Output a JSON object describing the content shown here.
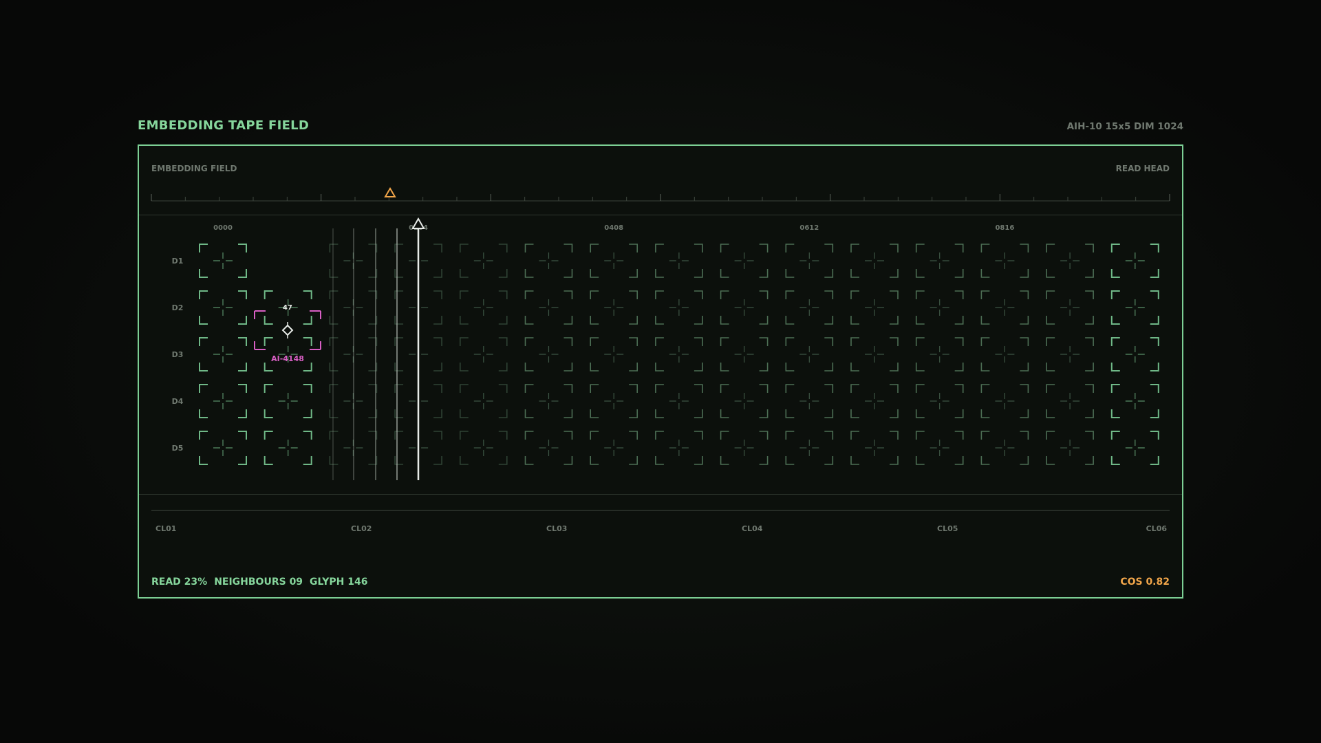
{
  "header": {
    "title": "EMBEDDING TAPE FIELD",
    "meta": "AIH-10  15x5  DIM 1024"
  },
  "ruler": {
    "left_label": "EMBEDDING FIELD",
    "right_label": "READ HEAD"
  },
  "field": {
    "column_labels": [
      "0000",
      "0204",
      "0408",
      "0612",
      "0816"
    ],
    "rows": [
      "D1",
      "D2",
      "D3",
      "D4",
      "D5"
    ],
    "selected": {
      "label": "AI-4148",
      "count": "47"
    }
  },
  "clusters": [
    "CL01",
    "CL02",
    "CL03",
    "CL04",
    "CL05",
    "CL06"
  ],
  "footer": {
    "read": "READ 23%",
    "neighbours": "NEIGHBOURS 09",
    "glyph": "GLYPH 146",
    "cos": "COS 0.82"
  },
  "colors": {
    "accent": "#7ccf94",
    "selection": "#d85fc4",
    "warning": "#f2a64a",
    "readhead": "#e8ece8"
  },
  "icons": {
    "ruler_marker": "warning-triangle-icon",
    "read_head": "triangle-pointer-icon",
    "selected_cell": "diamond-icon"
  }
}
